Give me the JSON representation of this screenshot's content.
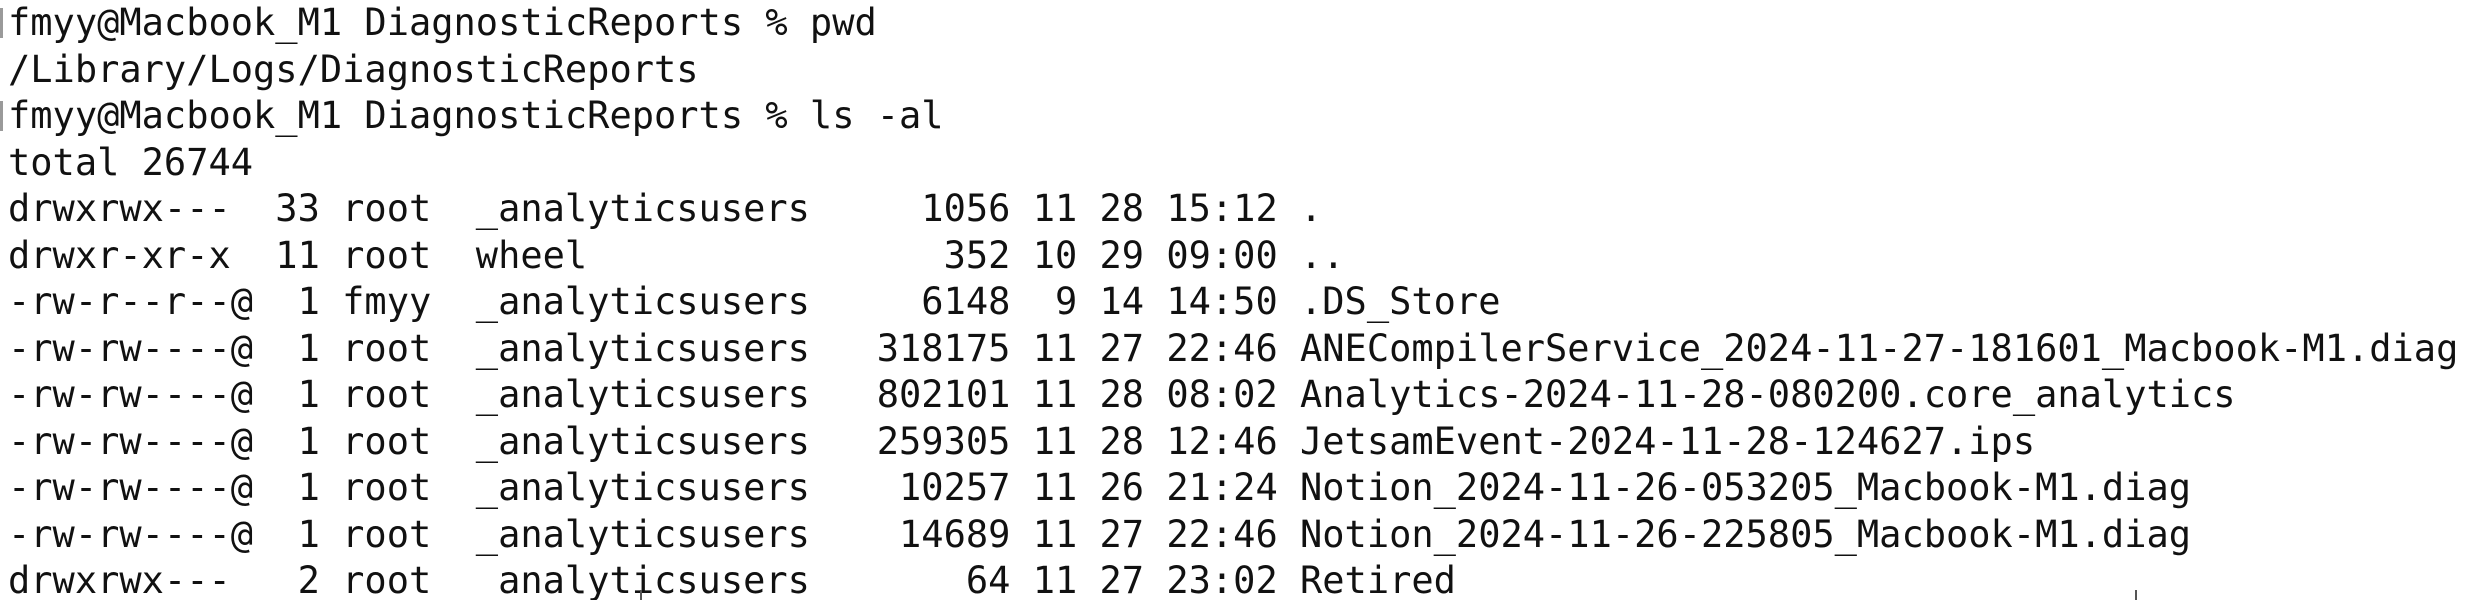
{
  "terminal": {
    "lines": [
      {
        "kind": "prompt",
        "text": "fmyy@Macbook_M1 DiagnosticReports % pwd"
      },
      {
        "kind": "output",
        "text": "/Library/Logs/DiagnosticReports"
      },
      {
        "kind": "prompt",
        "text": "fmyy@Macbook_M1 DiagnosticReports % ls -al"
      },
      {
        "kind": "output",
        "text": "total 26744"
      }
    ],
    "listing": [
      {
        "perms": "drwxrwx---",
        "links": "33",
        "owner": "root",
        "group": "_analyticsusers",
        "size": "1056",
        "month": "11",
        "day": "28",
        "time": "15:12",
        "name": "."
      },
      {
        "perms": "drwxr-xr-x",
        "links": "11",
        "owner": "root",
        "group": "wheel",
        "size": "352",
        "month": "10",
        "day": "29",
        "time": "09:00",
        "name": ".."
      },
      {
        "perms": "-rw-r--r--@",
        "links": "1",
        "owner": "fmyy",
        "group": "_analyticsusers",
        "size": "6148",
        "month": "9",
        "day": "14",
        "time": "14:50",
        "name": ".DS_Store"
      },
      {
        "perms": "-rw-rw----@",
        "links": "1",
        "owner": "root",
        "group": "_analyticsusers",
        "size": "318175",
        "month": "11",
        "day": "27",
        "time": "22:46",
        "name": "ANECompilerService_2024-11-27-181601_Macbook-M1.diag"
      },
      {
        "perms": "-rw-rw----@",
        "links": "1",
        "owner": "root",
        "group": "_analyticsusers",
        "size": "802101",
        "month": "11",
        "day": "28",
        "time": "08:02",
        "name": "Analytics-2024-11-28-080200.core_analytics"
      },
      {
        "perms": "-rw-rw----@",
        "links": "1",
        "owner": "root",
        "group": "_analyticsusers",
        "size": "259305",
        "month": "11",
        "day": "28",
        "time": "12:46",
        "name": "JetsamEvent-2024-11-28-124627.ips"
      },
      {
        "perms": "-rw-rw----@",
        "links": "1",
        "owner": "root",
        "group": "_analyticsusers",
        "size": "10257",
        "month": "11",
        "day": "26",
        "time": "21:24",
        "name": "Notion_2024-11-26-053205_Macbook-M1.diag"
      },
      {
        "perms": "-rw-rw----@",
        "links": "1",
        "owner": "root",
        "group": "_analyticsusers",
        "size": "14689",
        "month": "11",
        "day": "27",
        "time": "22:46",
        "name": "Notion_2024-11-26-225805_Macbook-M1.diag"
      },
      {
        "perms": "drwxrwx---",
        "links": "2",
        "owner": "root",
        "group": "_analyticsusers",
        "size": "64",
        "month": "11",
        "day": "27",
        "time": "23:02",
        "name": "Retired"
      }
    ]
  }
}
